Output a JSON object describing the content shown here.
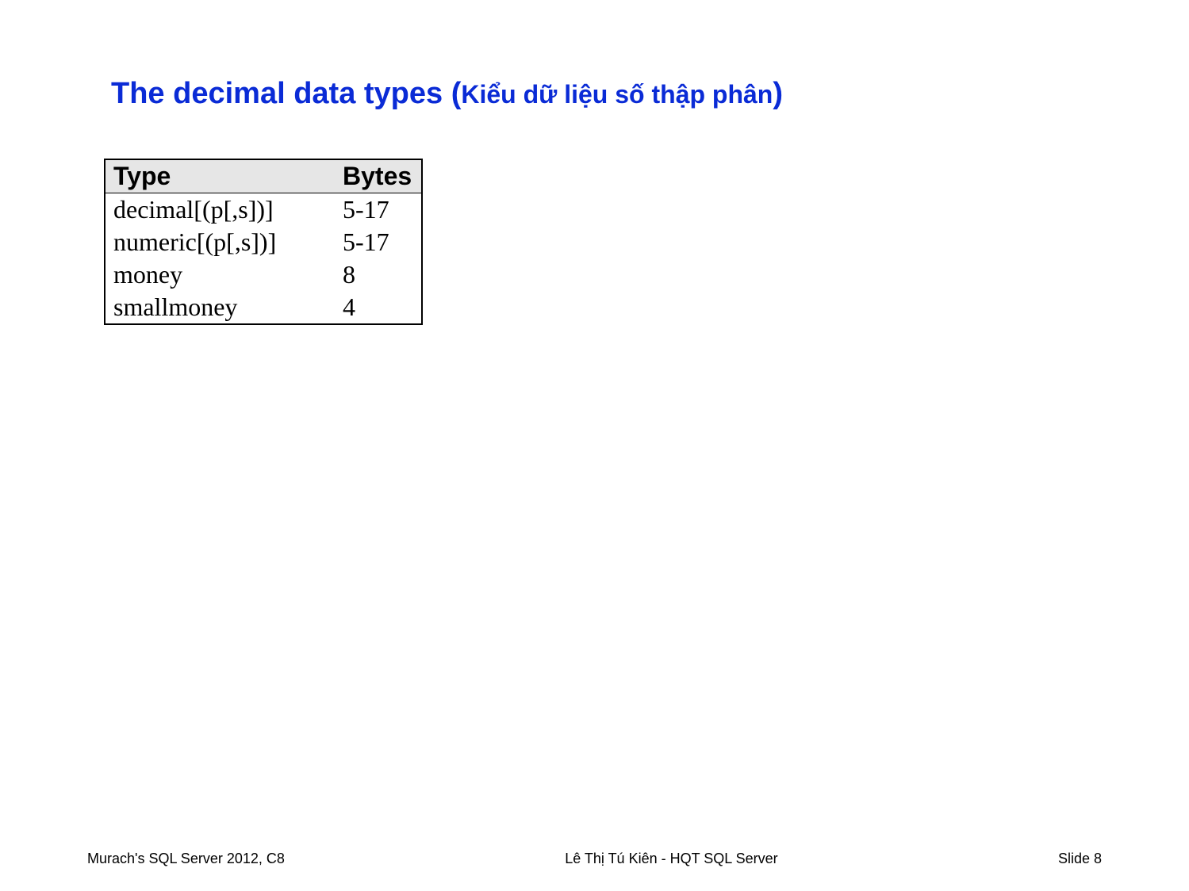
{
  "title": {
    "main": "The decimal data types ",
    "paren_open": "(",
    "sub": "Kiểu dữ liệu số thập phân",
    "paren_close": ")"
  },
  "table": {
    "headers": {
      "type": "Type",
      "bytes": "Bytes"
    },
    "rows": [
      {
        "type": "decimal[(p[,s])]",
        "bytes": "5-17"
      },
      {
        "type": "numeric[(p[,s])]",
        "bytes": "5-17"
      },
      {
        "type": "money",
        "bytes": "8"
      },
      {
        "type": "smallmoney",
        "bytes": "4"
      }
    ]
  },
  "footer": {
    "left": "Murach's SQL Server 2012, C8",
    "center": "Lê Thị Tú Kiên - HQT SQL Server",
    "right": "Slide 8"
  }
}
